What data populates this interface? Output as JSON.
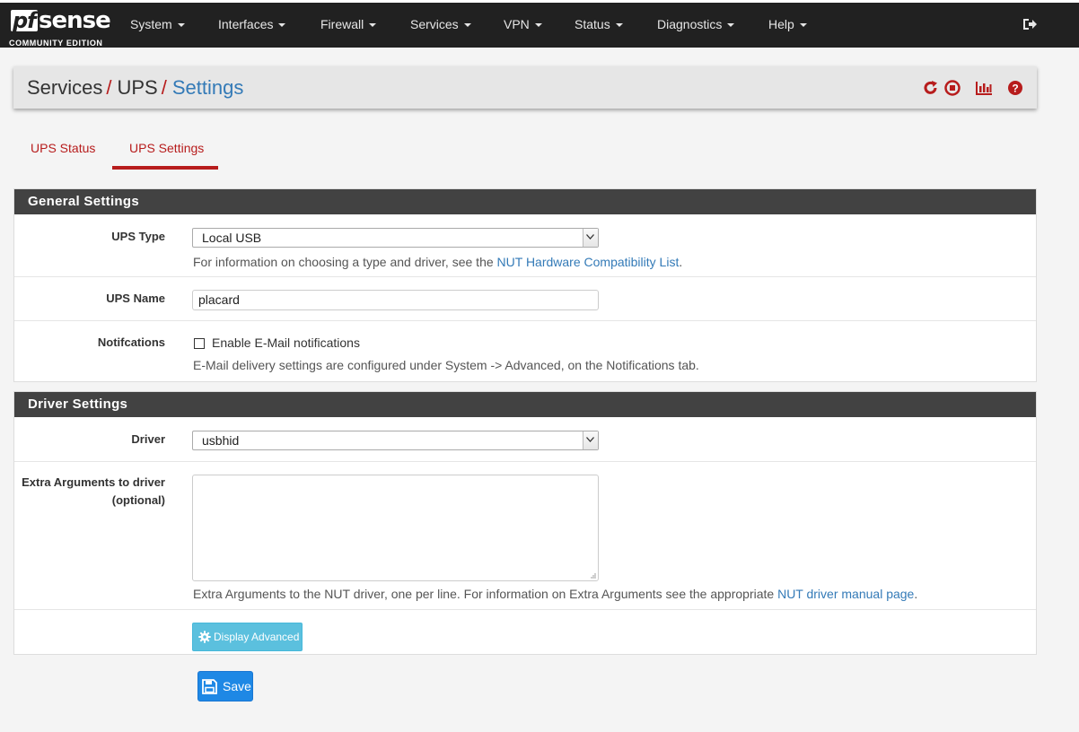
{
  "brand": {
    "logo_pf": "pf",
    "logo_sense": "sense",
    "edition": "COMMUNITY EDITION"
  },
  "nav": {
    "items": [
      "System",
      "Interfaces",
      "Firewall",
      "Services",
      "VPN",
      "Status",
      "Diagnostics",
      "Help"
    ],
    "logout_icon": "sign-out-icon"
  },
  "breadcrumb": {
    "part1": "Services",
    "part2": "UPS",
    "active": "Settings",
    "separator": "/"
  },
  "header_icons": [
    "restart-icon",
    "stop-icon",
    "chart-icon",
    "help-icon"
  ],
  "tabs": [
    {
      "label": "UPS Status",
      "active": false
    },
    {
      "label": "UPS Settings",
      "active": true
    }
  ],
  "general": {
    "heading": "General Settings",
    "ups_type": {
      "label": "UPS Type",
      "value": "Local USB",
      "help_prefix": "For information on choosing a type and driver, see the",
      "help_link": "NUT Hardware Compatibility List",
      "help_suffix": "."
    },
    "ups_name": {
      "label": "UPS Name",
      "value": "placard"
    },
    "notifications": {
      "label": "Notifcations",
      "checkbox_label": "Enable E-Mail notifications",
      "checked": false,
      "help": "E-Mail delivery settings are configured under System -> Advanced, on the Notifications tab."
    }
  },
  "driver": {
    "heading": "Driver Settings",
    "driver": {
      "label": "Driver",
      "value": "usbhid"
    },
    "extra_args": {
      "label_line1": "Extra Arguments to driver",
      "label_line2": "(optional)",
      "value": "",
      "help_prefix": "Extra Arguments to the NUT driver, one per line. For information on Extra Arguments see the appropriate",
      "help_link": "NUT driver manual page",
      "help_suffix": "."
    },
    "advanced_button": "Display Advanced"
  },
  "save_button": "Save",
  "colors": {
    "navbar": "#212121",
    "accent_red": "#b71c1c",
    "link_blue": "#337ab7",
    "panel_heading": "#424242",
    "info": "#5bc0de",
    "primary": "#1e88e5"
  }
}
